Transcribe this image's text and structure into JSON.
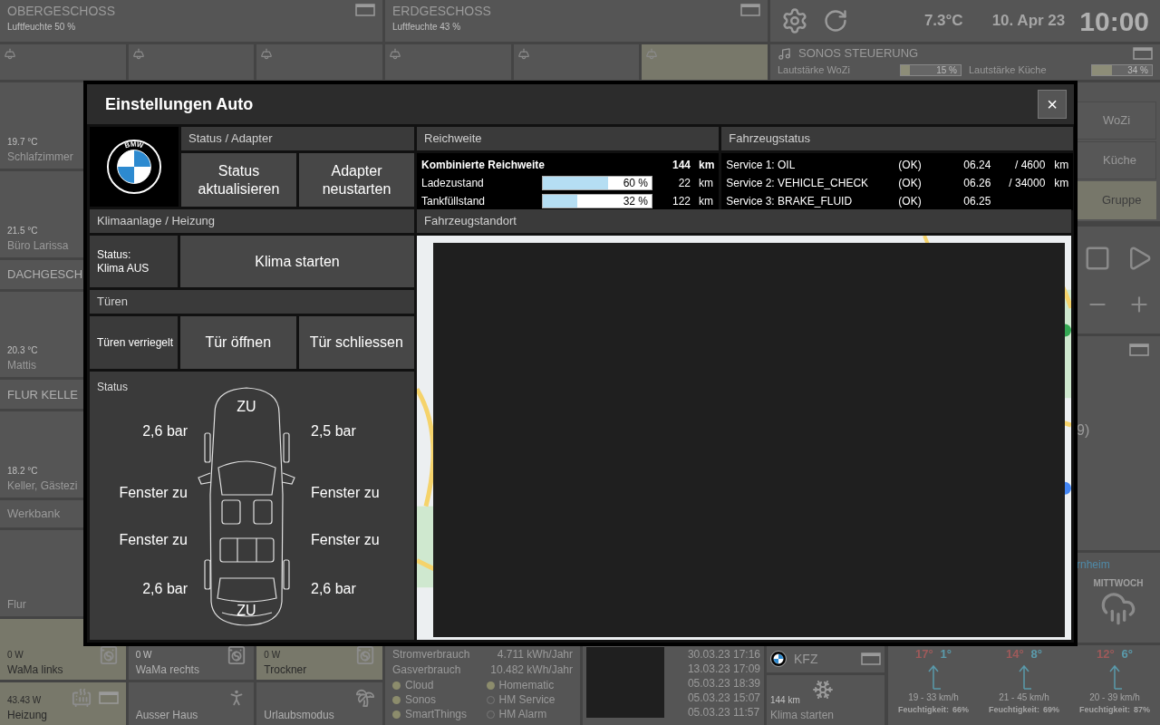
{
  "dashboard": {
    "floors": [
      {
        "title": "OBERGESCHOSS",
        "humidity": "Luftfeuchte 50 %",
        "tiles": [
          {
            "on": false
          },
          {
            "on": false
          },
          {
            "on": false
          }
        ]
      },
      {
        "title": "ERDGESCHOSS",
        "humidity": "Luftfeuchte 43 %",
        "tiles": [
          {
            "on": false
          },
          {
            "on": false
          },
          {
            "on": true
          }
        ]
      }
    ],
    "header": {
      "temperature": "7.3°C",
      "date": "10. Apr 23",
      "time": "10:00"
    },
    "sonos": {
      "title": "SONOS STEUERUNG",
      "volumes": [
        {
          "label": "Lautstärke WoZi",
          "level": 0.15,
          "reading": "15 %"
        },
        {
          "label": "Lautstärke Küche",
          "level": 0.34,
          "reading": "34 %"
        }
      ],
      "rooms": [
        {
          "label": "WoZi",
          "selected": false
        },
        {
          "label": "Küche",
          "selected": false
        },
        {
          "label": "Gruppe",
          "selected": true
        }
      ]
    },
    "left_tiles": [
      {
        "kind": "room",
        "temperature": "19.7 °C",
        "name": "Schlafzimmer"
      },
      {
        "kind": "room",
        "temperature": "21.5 °C",
        "name": "Büro Larissa"
      },
      {
        "kind": "header",
        "name": "DACHGESCH"
      },
      {
        "kind": "room",
        "temperature": "20.3 °C",
        "name": "Mattis"
      },
      {
        "kind": "header",
        "name": "FLUR KELLE"
      },
      {
        "kind": "room",
        "temperature": "18.2 °C",
        "name": "Keller, Gästezi"
      },
      {
        "kind": "label",
        "name": "Werkbank"
      },
      {
        "kind": "room",
        "name": "Flur"
      }
    ],
    "right_panel": {
      "text": "9)",
      "location": "rnheim",
      "weekday": "MITTWOCH"
    },
    "devices": [
      {
        "power": "0 W",
        "name": "WaMa links",
        "on": true
      },
      {
        "power": "0 W",
        "name": "WaMa rechts",
        "on": false
      },
      {
        "power": "0 W",
        "name": "Trockner",
        "on": true
      },
      {
        "power": "43.43 W",
        "name": "Heizung",
        "on": true
      },
      {
        "name": "Ausser Haus",
        "on": false
      },
      {
        "name": "Urlaubsmodus",
        "on": false
      }
    ],
    "energy": [
      {
        "label": "Stromverbrauch",
        "value": "4.711 kWh/Jahr"
      },
      {
        "label": "Gasverbrauch",
        "value": "10.482 kWh/Jahr"
      }
    ],
    "services": [
      {
        "name": "Cloud",
        "on": true
      },
      {
        "name": "Homematic",
        "on": true
      },
      {
        "name": "Sonos",
        "on": true
      },
      {
        "name": "HM Service",
        "on": false
      },
      {
        "name": "SmartThings",
        "on": true
      },
      {
        "name": "HM Alarm",
        "on": false
      }
    ],
    "log": [
      "30.03.23 17:16",
      "13.03.23 17:09",
      "05.03.23 18:39",
      "05.03.23 15:07",
      "05.03.23 11:57"
    ],
    "kfz": {
      "title": "KFZ",
      "range": "144 km",
      "action": "Klima starten"
    },
    "weather": [
      {
        "high": "17°",
        "low": "1°",
        "wind": "19 - 33 km/h",
        "humidity_label": "Feuchtigkeit:",
        "humidity": "66%"
      },
      {
        "high": "14°",
        "low": "8°",
        "wind": "21 - 45 km/h",
        "humidity_label": "Feuchtigkeit:",
        "humidity": "69%"
      },
      {
        "high": "12°",
        "low": "6°",
        "wind": "20 - 39 km/h",
        "humidity_label": "Feuchtigkeit:",
        "humidity": "87%"
      }
    ]
  },
  "dialog": {
    "title": "Einstellungen Auto",
    "close": "×",
    "logo_text": "BMW",
    "adapter": {
      "title": "Status / Adapter",
      "buttons": [
        "Status aktualisieren",
        "Adapter neustarten"
      ]
    },
    "climate": {
      "title": "Klimaanlage / Heizung",
      "status": "Status:\nKlima AUS",
      "button": "Klima starten"
    },
    "doors": {
      "title": "Türen",
      "status": "Türen verriegelt",
      "buttons": [
        "Tür öffnen",
        "Tür schliessen"
      ]
    },
    "car_status": {
      "title": "Status",
      "hood": "ZU",
      "trunk": "ZU",
      "tires": [
        "2,6 bar",
        "2,5 bar",
        "2,6 bar",
        "2,6 bar"
      ],
      "windows": [
        "Fenster zu",
        "Fenster zu",
        "Fenster zu",
        "Fenster zu"
      ]
    },
    "range": {
      "title": "Reichweite",
      "rows": [
        {
          "kind": "total",
          "label": "Kombinierte Reichweite",
          "value": "144",
          "unit": "km"
        },
        {
          "kind": "bar",
          "label": "Ladezustand",
          "level": 0.6,
          "reading": "60 %",
          "value": "22",
          "unit": "km"
        },
        {
          "kind": "bar",
          "label": "Tankfüllstand",
          "level": 0.32,
          "reading": "32 %",
          "value": "122",
          "unit": "km"
        }
      ]
    },
    "vehicle_status": {
      "title": "Fahrzeugstatus",
      "services": [
        {
          "name": "Service 1: OIL",
          "status": "(OK)",
          "date": "06.24",
          "distance": "/ 4600",
          "unit": "km"
        },
        {
          "name": "Service 2: VEHICLE_CHECK",
          "status": "(OK)",
          "date": "06.26",
          "distance": "/ 34000",
          "unit": "km"
        },
        {
          "name": "Service 3: BRAKE_FLUID",
          "status": "(OK)",
          "date": "06.25"
        }
      ]
    },
    "location": {
      "title": "Fahrzeugstandort"
    }
  }
}
